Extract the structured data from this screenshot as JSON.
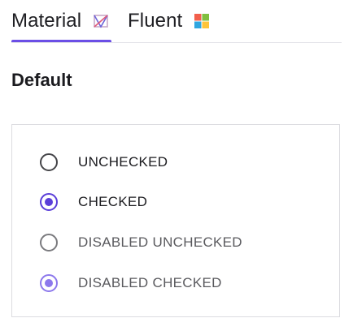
{
  "tabs": [
    {
      "label": "Material",
      "icon": "material-logo-icon",
      "selected": true
    },
    {
      "label": "Fluent",
      "icon": "windows-logo-icon",
      "selected": false
    }
  ],
  "section": {
    "title": "Default"
  },
  "radios": [
    {
      "label": "UNCHECKED",
      "checked": false,
      "disabled": false
    },
    {
      "label": "CHECKED",
      "checked": true,
      "disabled": false
    },
    {
      "label": "DISABLED UNCHECKED",
      "checked": false,
      "disabled": true
    },
    {
      "label": "DISABLED CHECKED",
      "checked": true,
      "disabled": true
    }
  ],
  "colors": {
    "accent": "#5b3fd9",
    "accent_disabled": "#8c78ec",
    "tab_indicator": "#6b4ee6"
  }
}
